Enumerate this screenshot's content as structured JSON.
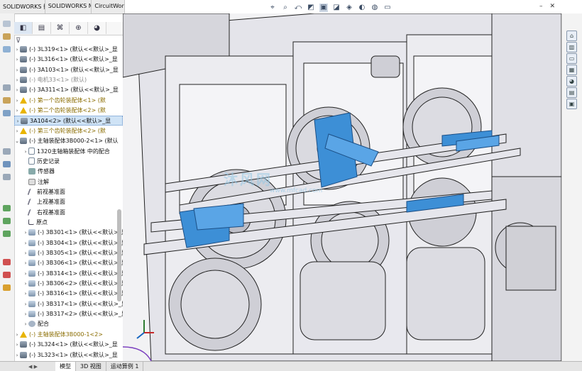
{
  "top_tabs": [
    "SOLIDWORKS 插件",
    "SOLIDWORKS MBD",
    "CircuitWorks"
  ],
  "feature_manager_tabs": [
    {
      "icon": "feature-tree-icon"
    },
    {
      "icon": "property-manager-icon"
    },
    {
      "icon": "configuration-manager-icon"
    },
    {
      "icon": "dimxpert-icon"
    },
    {
      "icon": "display-manager-icon"
    }
  ],
  "tree": [
    {
      "label": "(-) 3L319<1> (默认<<默认>_显",
      "icon": "asm",
      "style": "normal"
    },
    {
      "label": "(-) 3L316<1> (默认<<默认>_显",
      "icon": "asm",
      "style": "normal"
    },
    {
      "label": "(-) 3A103<1> (默认<<默认>_显",
      "icon": "asm",
      "style": "normal"
    },
    {
      "label": "(-) 电机33<1> (默认)",
      "icon": "asm",
      "style": "grey"
    },
    {
      "label": "(-) 3A311<1> (默认<<默认>_显",
      "icon": "asm",
      "style": "normal"
    },
    {
      "label": "(-) 第一个齿轮装配体<1> (默",
      "icon": "warn",
      "style": "warn"
    },
    {
      "label": "(-) 第二个齿轮装配体<2> (默",
      "icon": "warn",
      "style": "warn"
    },
    {
      "label": "3A104<2> (默认<<默认>_显",
      "icon": "asm",
      "style": "selected"
    },
    {
      "label": "(-) 第三个齿轮装配体<2> (默",
      "icon": "warn",
      "style": "warn"
    },
    {
      "label": "(-) 主轴装配体3B000-2<1> (默认",
      "icon": "asm",
      "style": "normal"
    },
    {
      "label": "1320主轴箱装配体 中的配合",
      "icon": "file",
      "style": "normal"
    },
    {
      "label": "历史记录",
      "icon": "file",
      "style": "normal"
    },
    {
      "label": "传感器",
      "icon": "sensor",
      "style": "normal"
    },
    {
      "label": "注解",
      "icon": "note",
      "style": "normal"
    },
    {
      "label": "前视基准面",
      "icon": "plane",
      "style": "normal"
    },
    {
      "label": "上视基准面",
      "icon": "plane",
      "style": "normal"
    },
    {
      "label": "右视基准面",
      "icon": "plane",
      "style": "normal"
    },
    {
      "label": "原点",
      "icon": "origin",
      "style": "normal"
    },
    {
      "label": "(-) 3B301<1> (默认<<默认>_显",
      "icon": "part",
      "style": "normal"
    },
    {
      "label": "(-) 3B304<1> (默认<<默认>_显",
      "icon": "part",
      "style": "normal"
    },
    {
      "label": "(-) 3B305<1> (默认<<默认>_显",
      "icon": "part",
      "style": "normal"
    },
    {
      "label": "(-) 3B306<1> (默认<<默认>_显",
      "icon": "part",
      "style": "normal"
    },
    {
      "label": "(-) 3B314<1> (默认<<默认>_显",
      "icon": "part",
      "style": "normal"
    },
    {
      "label": "(-) 3B306<2> (默认<<默认>_显",
      "icon": "part",
      "style": "normal"
    },
    {
      "label": "(-) 3B316<1> (默认<<默认>_显",
      "icon": "part",
      "style": "normal"
    },
    {
      "label": "(-) 3B317<1> (默认<<默认>_显",
      "icon": "part",
      "style": "normal"
    },
    {
      "label": "(-) 3B317<2> (默认<<默认>_显",
      "icon": "part",
      "style": "normal"
    },
    {
      "label": "配合",
      "icon": "mate",
      "style": "normal"
    },
    {
      "label": "(-) 主轴装配体3B000-1<2>",
      "icon": "warn",
      "style": "warn"
    },
    {
      "label": "(-) 3L324<1> (默认<<默认>_显",
      "icon": "asm",
      "style": "normal"
    },
    {
      "label": "(-) 3L323<1> (默认<<默认>_显",
      "icon": "asm",
      "style": "normal"
    }
  ],
  "bottom_tabs": [
    "模型",
    "3D 视图",
    "运动算例 1"
  ],
  "watermark": {
    "main": "沐风网",
    "sub": "www.mfcad.com"
  },
  "colors": {
    "highlight": "#3d8fd6",
    "selection": "#cfe3f6",
    "warning": "#e8b400",
    "model_grey": "#dcdce2"
  }
}
